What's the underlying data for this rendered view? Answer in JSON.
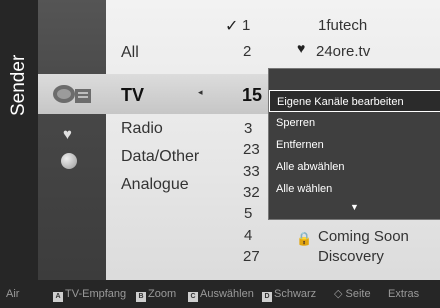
{
  "sidebar": {
    "title": "Sender"
  },
  "groups": {
    "all": "All",
    "tv": "TV",
    "radio": "Radio",
    "data": "Data/Other",
    "analogue": "Analogue"
  },
  "numbers": [
    "1",
    "2",
    "15",
    "3",
    "23",
    "33",
    "32",
    "5",
    "4",
    "27"
  ],
  "channels": {
    "ch1": "1futech",
    "ch2": "24ore.tv",
    "ch3": "Coming Soon",
    "ch4": "Discovery"
  },
  "icons": {
    "check": "✓",
    "heart": "♥",
    "lock": "🔒",
    "menu_down": "▼",
    "left_arrow": "◂"
  },
  "context_menu": [
    "Eigene Kanäle bearbeiten",
    "Sperren",
    "Entfernen",
    "Alle abwählen",
    "Alle wählen"
  ],
  "footer": {
    "air": "Air",
    "a_key": "A",
    "a_label": "TV-Empfang",
    "b_key": "B",
    "b_label": "Zoom",
    "c_key": "C",
    "c_label": "Auswählen",
    "d_key": "D",
    "d_label": "Schwarz",
    "page": "◇ Seite",
    "tools": "Extras"
  }
}
